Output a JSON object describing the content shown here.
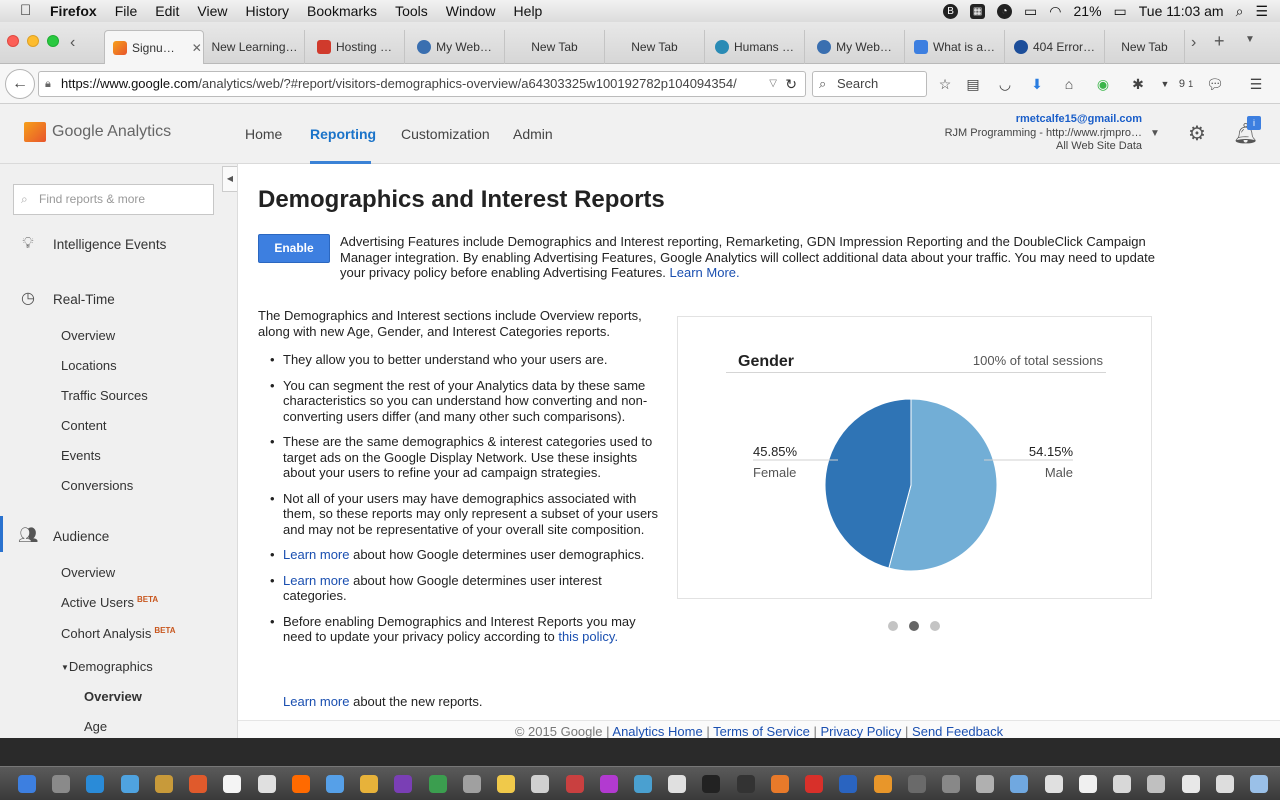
{
  "menubar": {
    "app": "Firefox",
    "items": [
      "File",
      "Edit",
      "View",
      "History",
      "Bookmarks",
      "Tools",
      "Window",
      "Help"
    ],
    "battery": "21%",
    "clock": "Tue 11:03 am"
  },
  "tabs": [
    {
      "label": "Signu…",
      "icon_color": "#e8732c"
    },
    {
      "label": "New Learning…",
      "icon_color": ""
    },
    {
      "label": "Hosting …",
      "icon_color": "#d03a2c"
    },
    {
      "label": "My Web…",
      "icon_color": "#3a6fb0"
    },
    {
      "label": "New Tab",
      "icon_color": ""
    },
    {
      "label": "New Tab",
      "icon_color": ""
    },
    {
      "label": "Humans …",
      "icon_color": "#2a8bb5"
    },
    {
      "label": "My Web…",
      "icon_color": "#3a6fb0"
    },
    {
      "label": "What is a…",
      "icon_color": "#3d7fe0"
    },
    {
      "label": "404 Error…",
      "icon_color": "#1d4e9a"
    },
    {
      "label": "New Tab",
      "icon_color": ""
    }
  ],
  "navbar": {
    "url_host": "https://www.google.com",
    "url_path": "/analytics/web/?#report/visitors-demographics-overview/a64303325w100192782p104094354/",
    "search_placeholder": "Search",
    "badge_count": "9",
    "badge_count2": "1"
  },
  "header": {
    "logo_text": "Google Analytics",
    "nav": [
      "Home",
      "Reporting",
      "Customization",
      "Admin"
    ],
    "active_nav": "Reporting",
    "account_email": "rmetcalfe15@gmail.com",
    "account_name": "RJM Programming - http://www.rjmpro…",
    "account_view": "All Web Site Data",
    "notification_badge": "i"
  },
  "sidebar": {
    "search_placeholder": "Find reports & more",
    "intelligence": "Intelligence Events",
    "realtime": "Real-Time",
    "realtime_items": [
      "Overview",
      "Locations",
      "Traffic Sources",
      "Content",
      "Events",
      "Conversions"
    ],
    "audience": "Audience",
    "audience_items": [
      {
        "label": "Overview",
        "beta": ""
      },
      {
        "label": "Active Users",
        "beta": "BETA"
      },
      {
        "label": "Cohort Analysis",
        "beta": "BETA"
      }
    ],
    "demographics": "Demographics",
    "demographics_items": [
      "Overview",
      "Age"
    ]
  },
  "main": {
    "title": "Demographics and Interest Reports",
    "enable_label": "Enable",
    "ad_text": "Advertising Features include Demographics and Interest reporting, Remarketing, GDN Impression Reporting and the DoubleClick Campaign Manager integration. By enabling Advertising Features, Google Analytics will collect additional data about your traffic. You may need to update your privacy policy before enabling Advertising Features.",
    "ad_link": "Learn More.",
    "intro": "The Demographics and Interest sections include Overview reports, along with new Age, Gender, and Interest Categories reports.",
    "bullets": [
      {
        "text": "They allow you to better understand who your users are."
      },
      {
        "text": "You can segment the rest of your Analytics data by these same characteristics so you can understand how converting and non-converting users differ (and many other such comparisons)."
      },
      {
        "text": "These are the same demographics & interest categories used to target ads on the Google Display Network. Use these insights about your users to refine your ad campaign strategies."
      },
      {
        "text": "Not all of your users may have demographics associated with them, so these reports may only represent a subset of your users and may not be representative of your overall site composition."
      }
    ],
    "learn1_link": "Learn more",
    "learn1_text": " about how Google determines user demographics.",
    "learn2_link": "Learn more",
    "learn2_text": " about how Google determines user interest categories.",
    "policy_text": "Before enabling Demographics and Interest Reports you may need to update your privacy policy according to ",
    "policy_link": "this policy.",
    "learn3_link": "Learn more",
    "learn3_text": " about the new reports."
  },
  "chart_data": {
    "type": "pie",
    "title": "Gender",
    "subtitle": "100% of total sessions",
    "categories": [
      "Female",
      "Male"
    ],
    "values": [
      45.85,
      54.15
    ],
    "value_labels": [
      "45.85%",
      "54.15%"
    ],
    "colors": [
      "#2f74b5",
      "#72aed6"
    ]
  },
  "carousel": {
    "pages": 3,
    "active": 1
  },
  "footer": {
    "copyright": "© 2015 Google |",
    "links": [
      "Analytics Home",
      "Terms of Service",
      "Privacy Policy",
      "Send Feedback"
    ]
  }
}
